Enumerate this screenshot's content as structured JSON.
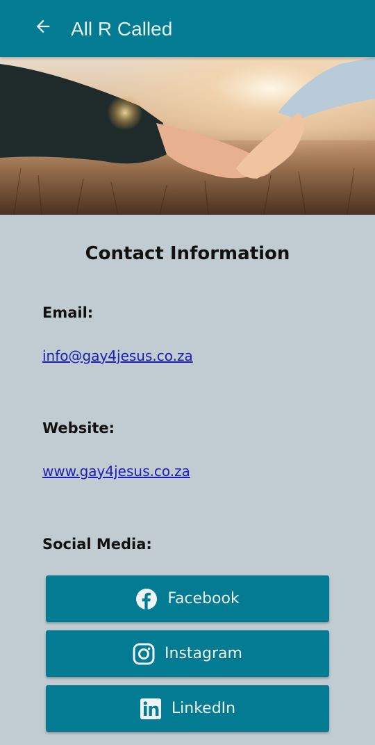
{
  "appbar": {
    "title": "All R Called",
    "back_icon": "arrow-left-icon",
    "background": "#037b93"
  },
  "hero": {
    "image": "holding-hands-photo"
  },
  "contact": {
    "title": "Contact Information",
    "email_label": "Email:",
    "email_value": "info@gay4jesus.co.za",
    "website_label": "Website:",
    "website_value": "www.gay4jesus.co.za",
    "social_label": "Social Media:"
  },
  "social": {
    "buttons": [
      {
        "label": "Facebook",
        "icon": "facebook-icon"
      },
      {
        "label": "Instagram",
        "icon": "instagram-icon"
      },
      {
        "label": "LinkedIn",
        "icon": "linkedin-icon"
      }
    ]
  },
  "colors": {
    "page_background": "#c0cbd2",
    "accent": "#037b93",
    "link": "#1d1db3"
  }
}
